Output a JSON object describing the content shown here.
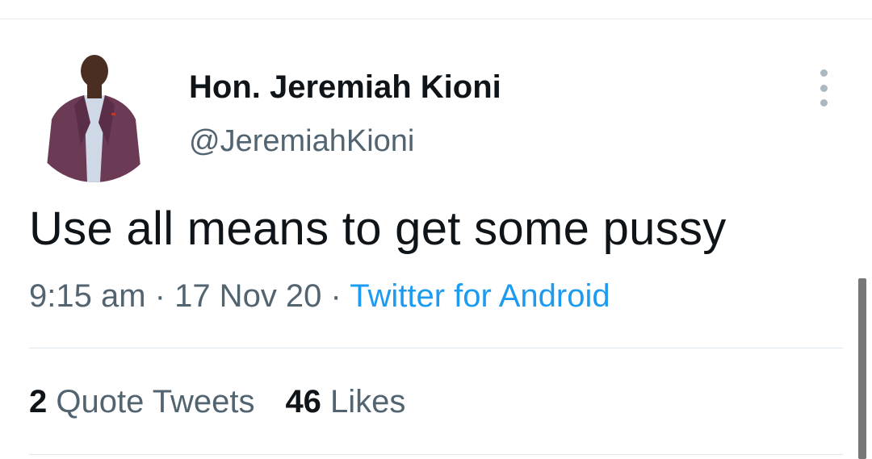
{
  "tweet": {
    "author": {
      "name": "Hon. Jeremiah Kioni",
      "handle": "@JeremiahKioni",
      "avatar_icon": "profile-photo"
    },
    "more_icon": "more-vertical-icon",
    "text": "Use all means to get some pussy",
    "meta": {
      "time": "9:15 am",
      "separator": " · ",
      "date": "17 Nov 20",
      "source": "Twitter for Android"
    },
    "stats": {
      "quote_tweets_count": "2",
      "quote_tweets_label": " Quote Tweets",
      "likes_count": "46",
      "likes_label": " Likes"
    }
  },
  "colors": {
    "primary_text": "#0f1419",
    "secondary_text": "#536471",
    "link": "#1d9bf0",
    "divider": "#e1e8ed"
  }
}
